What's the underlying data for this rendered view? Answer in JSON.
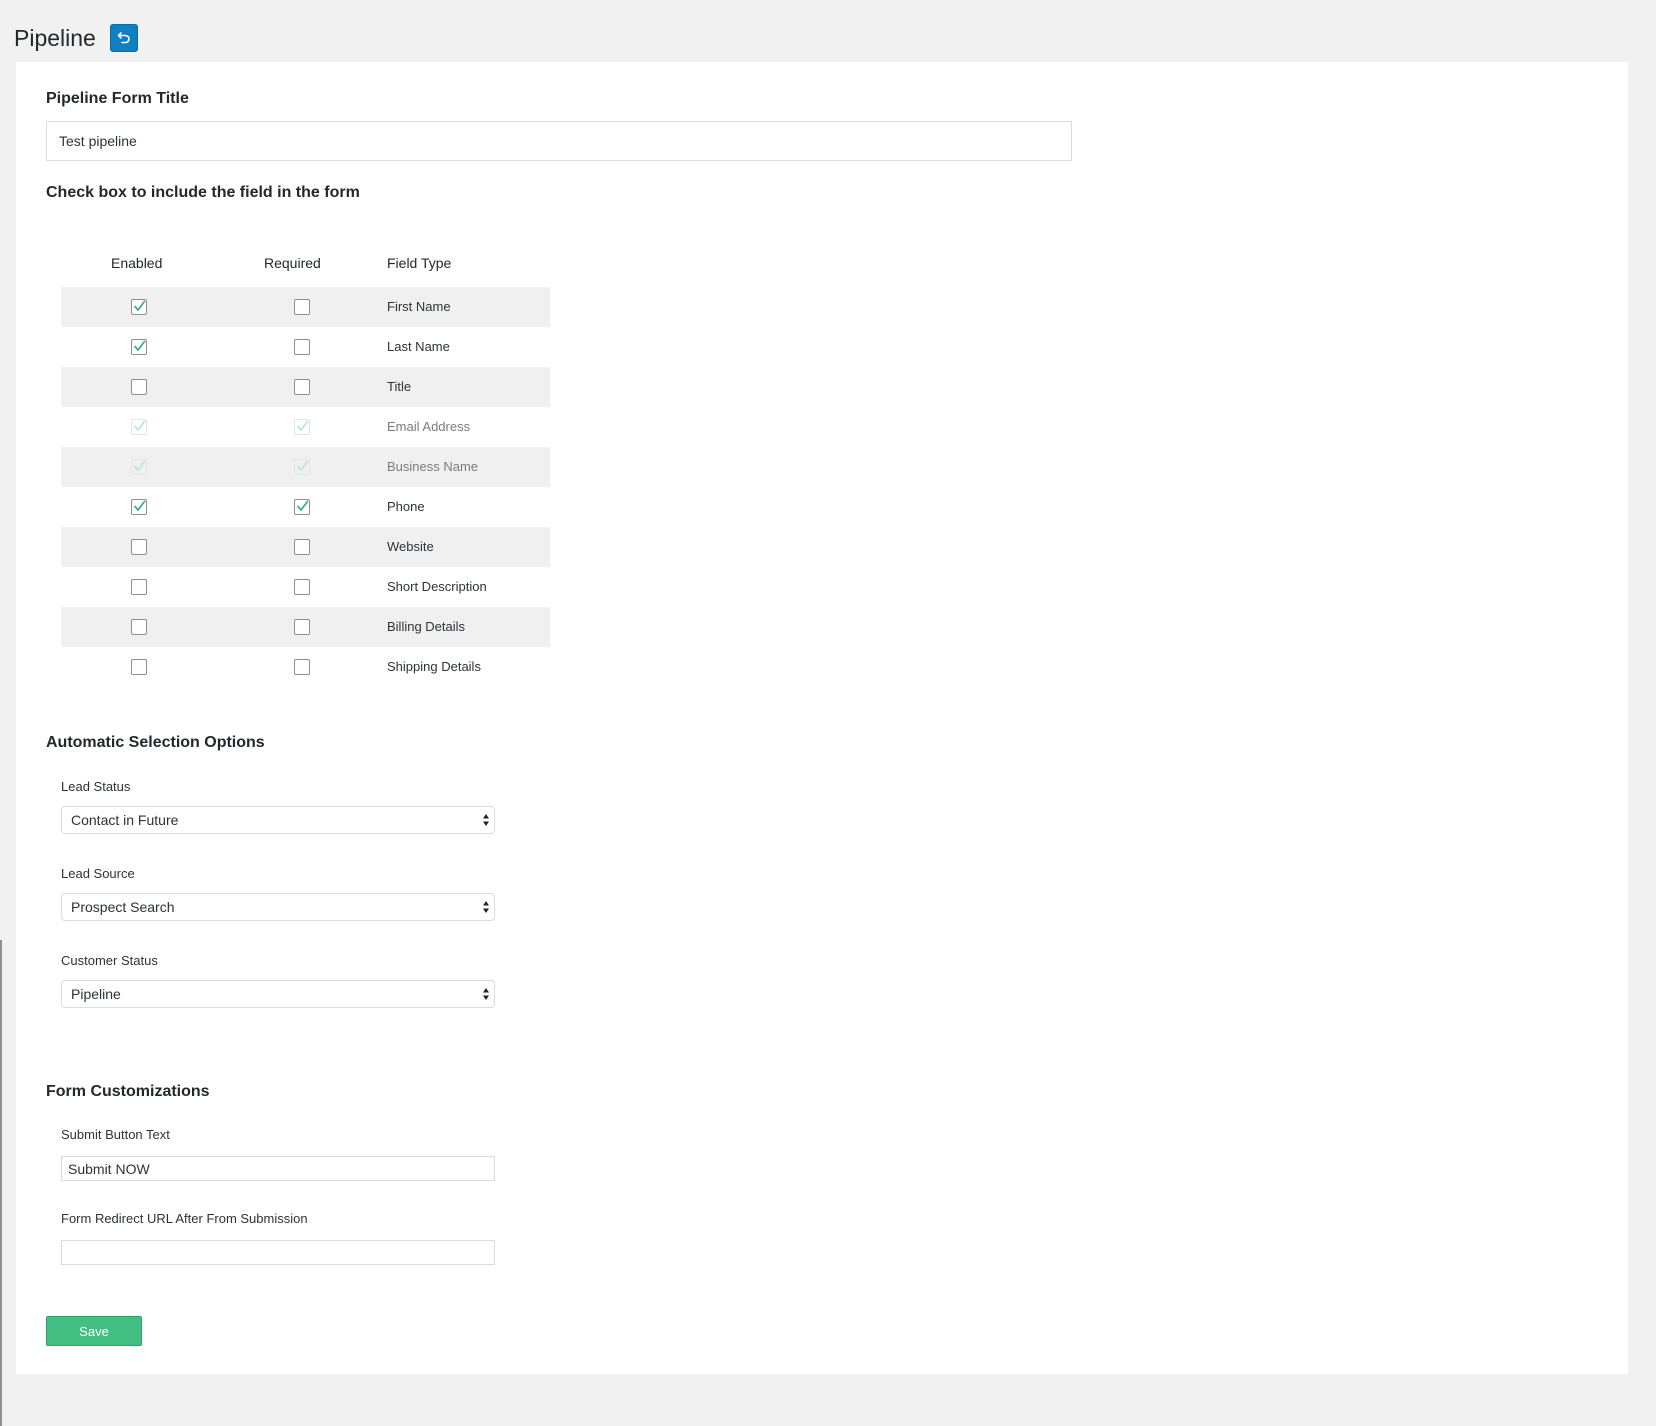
{
  "page": {
    "title": "Pipeline",
    "back_icon": "undo-icon",
    "accent": "#0f7fc2"
  },
  "form_title": {
    "heading": "Pipeline Form Title",
    "value": "Test pipeline"
  },
  "fields": {
    "heading": "Check box to include the field in the form",
    "columns": {
      "enabled": "Enabled",
      "required": "Required",
      "field_type": "Field Type"
    },
    "rows": [
      {
        "label": "First Name",
        "enabled": true,
        "required": false,
        "locked": false
      },
      {
        "label": "Last Name",
        "enabled": true,
        "required": false,
        "locked": false
      },
      {
        "label": "Title",
        "enabled": false,
        "required": false,
        "locked": false
      },
      {
        "label": "Email Address",
        "enabled": true,
        "required": true,
        "locked": true
      },
      {
        "label": "Business Name",
        "enabled": true,
        "required": true,
        "locked": true
      },
      {
        "label": "Phone",
        "enabled": true,
        "required": true,
        "locked": false
      },
      {
        "label": "Website",
        "enabled": false,
        "required": false,
        "locked": false
      },
      {
        "label": "Short Description",
        "enabled": false,
        "required": false,
        "locked": false
      },
      {
        "label": "Billing Details",
        "enabled": false,
        "required": false,
        "locked": false
      },
      {
        "label": "Shipping Details",
        "enabled": false,
        "required": false,
        "locked": false
      }
    ]
  },
  "auto_selection": {
    "heading": "Automatic Selection Options",
    "lead_status": {
      "label": "Lead Status",
      "value": "Contact in Future"
    },
    "lead_source": {
      "label": "Lead Source",
      "value": "Prospect Search"
    },
    "customer_status": {
      "label": "Customer Status",
      "value": "Pipeline"
    }
  },
  "customizations": {
    "heading": "Form Customizations",
    "submit_text": {
      "label": "Submit Button Text",
      "value": "Submit NOW"
    },
    "redirect_url": {
      "label": "Form Redirect URL After From Submission",
      "value": ""
    }
  },
  "save_label": "Save",
  "colors": {
    "check": "#3bb37a",
    "check_dim": "#bfe6d2",
    "save": "#44bf83"
  }
}
